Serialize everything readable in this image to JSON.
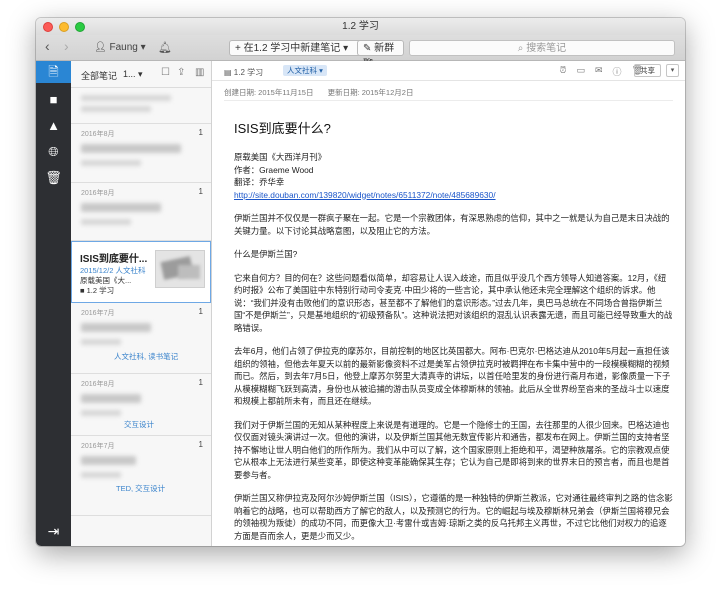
{
  "window": {
    "title": "1.2 学习"
  },
  "toolbar": {
    "back": "‹",
    "forward": "›",
    "user": "Faung ▾",
    "bell_icon": "bell-icon",
    "new_note": "+ 在1.2 学习中新建笔记  ▾",
    "new_chat": "新群聊",
    "search_placeholder": "搜索笔记"
  },
  "sidebar": {
    "items": [
      "notes-icon",
      "notebook-icon",
      "tag-icon",
      "shared-icon",
      "trash-icon"
    ],
    "bottom": "sync-icon"
  },
  "notelist": {
    "filter": "全部笔记",
    "count": "1... ▾",
    "notes": [
      {
        "date": "2016年8月",
        "num": "1",
        "tag": ""
      },
      {
        "date": "2016年8月",
        "num": "1",
        "tag": ""
      },
      {
        "title": "ISIS到底要什...",
        "date": "2015/12/2",
        "tag": "人文社科",
        "extra": "原载美国《大...",
        "notebook": "1.2 学习"
      },
      {
        "date": "2016年7月",
        "num": "1",
        "tag": "人文社科, 读书笔记"
      },
      {
        "date": "2016年8月",
        "num": "1",
        "tag": "交互设计"
      },
      {
        "date": "2016年7月",
        "num": "1",
        "tag": "TED, 交互设计"
      }
    ]
  },
  "editor": {
    "notebook": "1.2 学习",
    "tag": "人文社科 ▾",
    "share": "共享",
    "created": "创建日期: 2015年11月15日",
    "updated": "更新日期: 2015年12月2日",
    "title": "ISIS到底要什么?",
    "source": "原载美国《大西洋月刊》",
    "author": "作者：Graeme Wood",
    "translator": "翻译：乔华幸",
    "link": "http://site.douban.com/139820/widget/notes/6511372/note/485689630/",
    "p1": "伊斯兰国并不仅仅是一群疯子聚在一起。它是一个宗教团体，有深思熟虑的信仰，其中之一就是认为自己是末日决战的关键力量。以下讨论其战略意图，以及阻止它的方法。",
    "q1": "什么是伊斯兰国?",
    "p2": "它来自何方？目的何在？这些问题看似简单，却容易让人误入歧途，而且似乎没几个西方领导人知道答案。12月，《纽约时报》公布了美国驻中东特别行动司令麦克·中田少将的一些言论，其中承认他还未完全理解这个组织的诉求。他说：“我们并没有击败他们的意识形态，甚至都不了解他们的意识形态。”过去几年，奥巴马总统在不同场合曾指伊斯兰国“不是伊斯兰”，只是基地组织的“初级预备队”。这种说法把对该组织的混乱认识表露无遗，而且可能已经导致重大的战略错误。",
    "p3": "去年6月，他们占领了伊拉克的摩苏尔，目前控制的地区比英国都大。阿布·巴克尔·巴格达迪从2010年5月起一直担任该组织的领袖，但他去年夏天以前的最新影像资料不过是美军占领伊拉克时被羁押在布卡集中营中的一段模模糊糊的视频而已。然后，到去年7月5日，他登上摩苏尔努里大清真寺的讲坛，以首任哈里发的身份进行斋月布道，影像质量一下子从模模糊糊飞跃到高清，身份也从被追捕的游击队员变成全体穆斯林的领袖。此后从全世界纷至沓来的圣战斗士以速度和规模上都前所未有，而且还在继续。",
    "p4": "我们对于伊斯兰国的无知从某种程度上来说是有道理的。它是一个隐修士的王国，去往那里的人很少回来。巴格达迪也仅仅面对镜头演讲过一次。但他的演讲，以及伊斯兰国其他无数宣传影片和通告，都发布在网上。伊斯兰国的支持者坚持不懈地让世人明白他们的所作所为。我们从中可以了解，这个国家原则上拒绝和平，渴望种族屠杀。它的宗教观点使它从根本上无法进行某些变革，即使这种变革能确保其生存；它认为自己是即将到来的世界末日的预言者，而且也是首要参与者。",
    "p5": "伊斯兰国又称伊拉克及阿尔沙姆伊斯兰国（ISIS），它遵循的是一种独特的伊斯兰教派，它对通往最终审判之路的信念影响着它的战略，也可以帮助西方了解它的敌人，以及预测它的行为。它的崛起与埃及穆斯林兄弟会（伊斯兰国将穆兄会的领袖视为叛徒）的成功不同，而更像大卫·考雷什或吉姆·琼斯之类的反乌托邦主义再世，不过它比他们对权力的追逐方面是百而余人，更是少而又少。"
  }
}
